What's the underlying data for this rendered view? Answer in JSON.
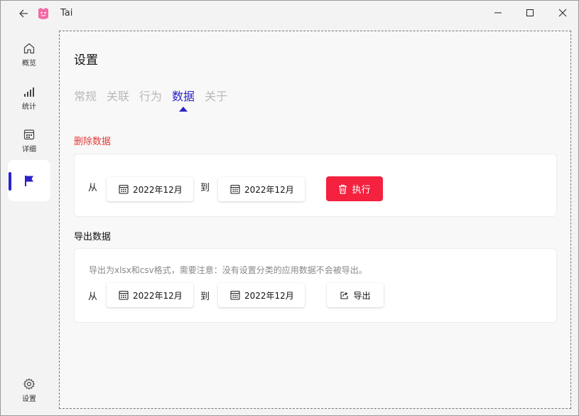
{
  "app": {
    "title": "Tai"
  },
  "sidebar": {
    "items": [
      {
        "label": "概览",
        "icon": "home-icon"
      },
      {
        "label": "统计",
        "icon": "bar-signal-icon"
      },
      {
        "label": "详细",
        "icon": "calendar-icon"
      },
      {
        "label": "",
        "icon": "flag-icon",
        "active": true
      },
      {
        "label": "设置",
        "icon": "gear-icon"
      }
    ]
  },
  "page": {
    "title": "设置",
    "tabs": [
      {
        "label": "常规"
      },
      {
        "label": "关联"
      },
      {
        "label": "行为"
      },
      {
        "label": "数据",
        "active": true
      },
      {
        "label": "关于"
      }
    ]
  },
  "delete_section": {
    "title": "删除数据",
    "from_label": "从",
    "to_label": "到",
    "start_date": "2022年12月",
    "end_date": "2022年12月",
    "action_label": "执行"
  },
  "export_section": {
    "title": "导出数据",
    "hint": "导出为xlsx和csv格式，需要注意：没有设置分类的应用数据不会被导出。",
    "from_label": "从",
    "to_label": "到",
    "start_date": "2022年12月",
    "end_date": "2022年12月",
    "action_label": "导出"
  },
  "colors": {
    "accent": "#2b23c8",
    "danger": "#f4213f",
    "danger_text": "#e53b3b"
  }
}
